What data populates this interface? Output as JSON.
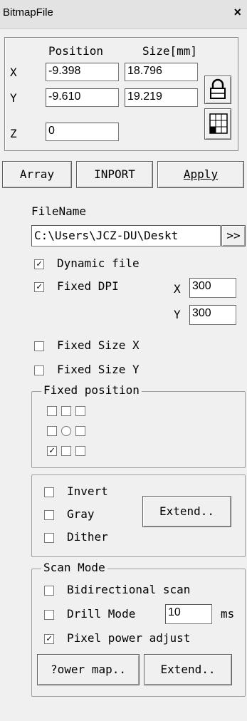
{
  "window": {
    "title": "BitmapFile",
    "close_label": "×"
  },
  "transform": {
    "position_header": "Position",
    "size_header": "Size[mm]",
    "x_label": "X",
    "y_label": "Y",
    "z_label": "Z",
    "x_position": "-9.398",
    "x_size": "18.796",
    "y_position": "-9.610",
    "y_size": "19.219",
    "z_value": "0"
  },
  "toolbar": {
    "array_label": "Array",
    "import_label": "INPORT",
    "apply_label": "Apply"
  },
  "file": {
    "filename_label": "FileName",
    "path": "C:\\Users\\JCZ-DU\\Deskt",
    "browse_label": ">>"
  },
  "options": {
    "dynamic_file": {
      "label": "Dynamic file",
      "checked": true
    },
    "fixed_dpi": {
      "label": "Fixed DPI",
      "checked": true,
      "x_label": "X",
      "y_label": "Y",
      "x_value": "300",
      "y_value": "300"
    },
    "fixed_size_x": {
      "label": "Fixed Size X",
      "checked": false
    },
    "fixed_size_y": {
      "label": "Fixed Size Y",
      "checked": false
    }
  },
  "fixed_position": {
    "title": "Fixed position",
    "selected": "bottom-left"
  },
  "image": {
    "invert": {
      "label": "Invert",
      "checked": false
    },
    "gray": {
      "label": "Gray",
      "checked": false
    },
    "dither": {
      "label": "Dither",
      "checked": false
    },
    "extend_label": "Extend.."
  },
  "scan_mode": {
    "title": "Scan Mode",
    "bidirectional": {
      "label": "Bidirectional scan",
      "checked": false
    },
    "drill_mode": {
      "label": "Drill Mode",
      "checked": false,
      "value": "10",
      "unit": "ms"
    },
    "pixel_power": {
      "label": "Pixel power adjust",
      "checked": true
    },
    "power_map_label": "?ower map..",
    "extend_label": "Extend.."
  }
}
